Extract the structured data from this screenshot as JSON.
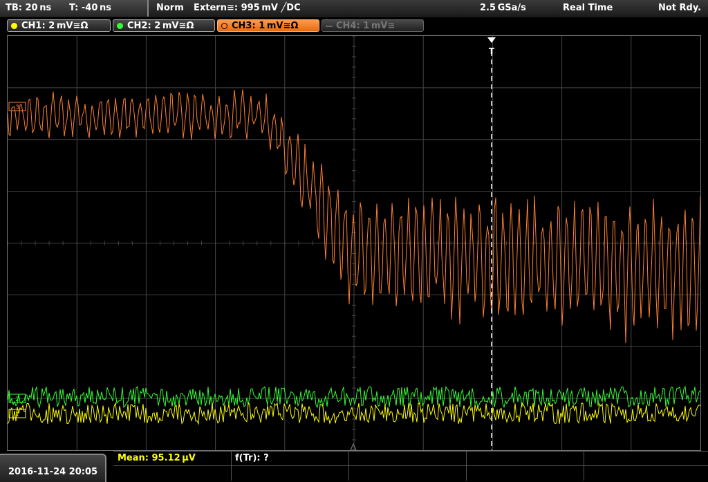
{
  "topbar": {
    "timebase": "TB: 20 ns",
    "trigger_offset": "T: -40 ns",
    "mode": "Norm",
    "trigger_source": "Extern≅: 995 mV ╱DC",
    "sample_rate": "2.5 GSa/s",
    "acquisition": "Real Time",
    "status": "Not Rdy."
  },
  "channels": [
    {
      "label": "CH1: 2 mV≅Ω",
      "color": "#ffff00",
      "state": "on"
    },
    {
      "label": "CH2: 2 mV≅Ω",
      "color": "#33ff33",
      "state": "on"
    },
    {
      "label": "CH3: 1 mV≅Ω",
      "color": "#ff8030",
      "state": "active"
    },
    {
      "label": "CH4: 1 mV≅",
      "color": "#777777",
      "state": "off"
    }
  ],
  "ch_markers": {
    "ch3": "3",
    "ch2": "2",
    "ch1": "1"
  },
  "trigger_marker": "T",
  "footer": {
    "datetime": "2016-11-24 20:05",
    "measure_1": "Mean: 95.12 µV",
    "measure_2": "f(Tr): ?"
  },
  "colors": {
    "ch1": "#ffff00",
    "ch2": "#33ff33",
    "ch3": "#ff8030",
    "grid": "#555555"
  }
}
